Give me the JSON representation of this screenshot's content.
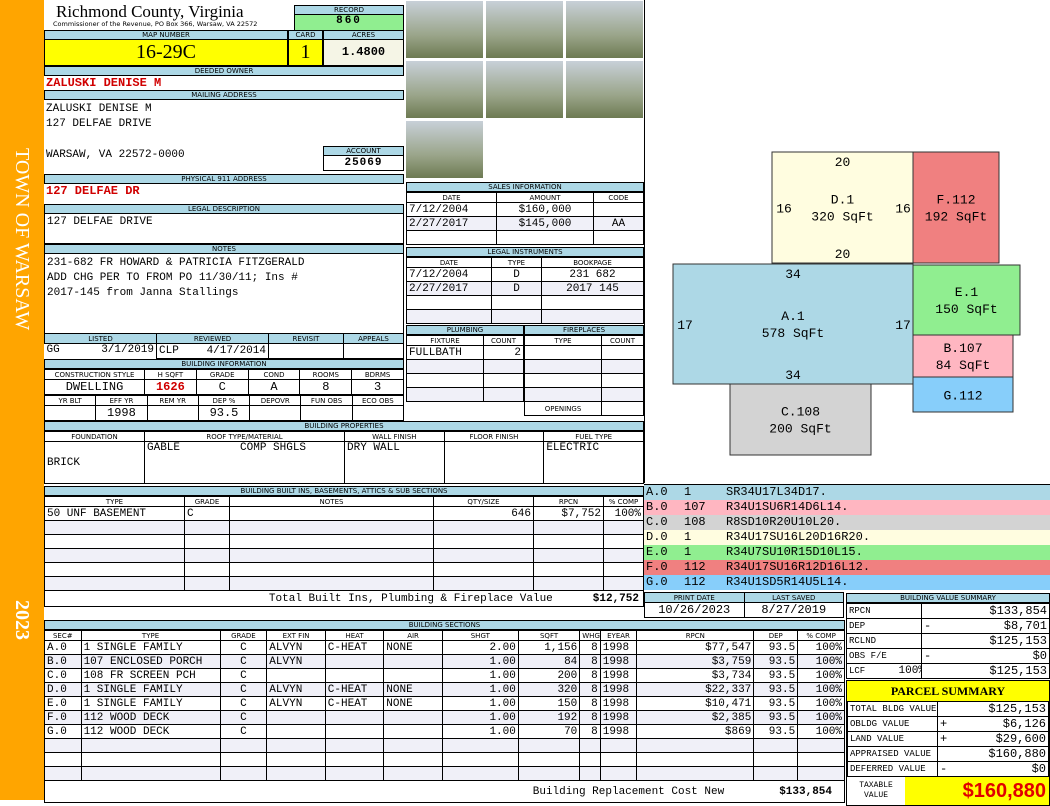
{
  "side": {
    "town": "TOWN OF WARSAW",
    "year": "2023"
  },
  "header": {
    "title": "Richmond County, Virginia",
    "subtitle": "Commissioner of the Revenue, PO Box 366, Warsaw, VA 22572",
    "record_label": "RECORD",
    "record": "860"
  },
  "map": {
    "map_label": "MAP NUMBER",
    "map": "16-29C",
    "card_label": "CARD",
    "card": "1",
    "acres_label": "ACRES",
    "acres": "1.4800"
  },
  "owner": {
    "label": "DEEDED OWNER",
    "name": "ZALUSKI DENISE M"
  },
  "mailing": {
    "label": "MAILING ADDRESS",
    "line1": "ZALUSKI DENISE M",
    "line2": "127 DELFAE DRIVE",
    "line3": "WARSAW, VA 22572-0000",
    "account_label": "ACCOUNT",
    "account": "25069"
  },
  "physical": {
    "label": "PHYSICAL 911 ADDRESS",
    "value": "127 DELFAE DR"
  },
  "legal": {
    "label": "LEGAL DESCRIPTION",
    "value": "127 DELFAE DRIVE"
  },
  "notes": {
    "label": "NOTES",
    "line1": "231-682 FR HOWARD & PATRICIA FITZGERALD",
    "line2": "ADD CHG PER TO FROM PO 11/30/11; Ins #",
    "line3": "2017-145 from Janna Stallings"
  },
  "review": {
    "headers": [
      "LISTED",
      "REVIEWED",
      "REVISIT",
      "APPEALS"
    ],
    "listed_by": "GG",
    "listed": "3/1/2019",
    "reviewed_by": "CLP",
    "reviewed": "4/17/2014"
  },
  "building_info": {
    "label": "BUILDING INFORMATION",
    "headers1": [
      "CONSTRUCTION STYLE",
      "H SQFT",
      "GRADE",
      "COND",
      "ROOMS",
      "BDRMS"
    ],
    "row1": [
      "DWELLING",
      "1626",
      "C",
      "A",
      "8",
      "3"
    ],
    "headers2": [
      "YR BLT",
      "EFF YR",
      "REM YR",
      "DEP %",
      "DEPOVR",
      "FUN OBS",
      "ECO OBS"
    ],
    "row2": [
      "",
      "1998",
      "",
      "93.5",
      "",
      "",
      ""
    ]
  },
  "sales": {
    "label": "SALES INFORMATION",
    "headers": [
      "DATE",
      "AMOUNT",
      "CODE"
    ],
    "rows": [
      [
        "7/12/2004",
        "$160,000",
        ""
      ],
      [
        "2/27/2017",
        "$145,000",
        "AA"
      ],
      [
        "",
        "",
        ""
      ]
    ]
  },
  "instruments": {
    "label": "LEGAL INSTRUMENTS",
    "headers": [
      "DATE",
      "TYPE",
      "BOOKPAGE"
    ],
    "rows": [
      [
        "7/12/2004",
        "D",
        "231 682"
      ],
      [
        "2/27/2017",
        "D",
        "2017 145"
      ],
      [
        "",
        "",
        ""
      ],
      [
        "",
        "",
        ""
      ]
    ]
  },
  "plumbing": {
    "label": "PLUMBING",
    "headers": [
      "FIXTURE",
      "COUNT"
    ],
    "rows": [
      [
        "FULLBATH",
        "2"
      ],
      [
        "",
        ""
      ],
      [
        "",
        ""
      ],
      [
        "",
        ""
      ]
    ]
  },
  "fireplaces": {
    "label": "FIREPLACES",
    "headers": [
      "TYPE",
      "COUNT"
    ],
    "openings": "OPENINGS"
  },
  "properties": {
    "label": "BUILDING PROPERTIES",
    "headers": [
      "FOUNDATION",
      "ROOF TYPE/MATERIAL",
      "WALL FINISH",
      "FLOOR FINISH",
      "FUEL TYPE"
    ],
    "foundation": "BRICK",
    "roof_type": "GABLE",
    "roof_material": "COMP SHGLS",
    "wall": "DRY WALL",
    "floor": "",
    "fuel": "ELECTRIC"
  },
  "builtins": {
    "label": "BUILDING BUILT INS, BASEMENTS, ATTICS & SUB SECTIONS",
    "headers": [
      "TYPE",
      "GRADE",
      "NOTES",
      "QTY/SIZE",
      "RPCN",
      "% COMP"
    ],
    "rows": [
      [
        "50 UNF BASEMENT",
        "C",
        "",
        "646",
        "$7,752",
        "100%"
      ],
      [
        "",
        "",
        "",
        "",
        "",
        ""
      ],
      [
        "",
        "",
        "",
        "",
        "",
        ""
      ],
      [
        "",
        "",
        "",
        "",
        "",
        ""
      ],
      [
        "",
        "",
        "",
        "",
        "",
        ""
      ],
      [
        "",
        "",
        "",
        "",
        "",
        ""
      ]
    ],
    "total_label": "Total Built Ins, Plumbing & Fireplace Value",
    "total": "$12,752"
  },
  "sections": {
    "label": "BUILDING SECTIONS",
    "headers": [
      "SEC#",
      "TYPE",
      "GRADE",
      "EXT FIN",
      "HEAT",
      "AIR",
      "SHGT",
      "SQFT",
      "WHGT",
      "EYEAR",
      "RPCN",
      "DEP",
      "% COMP"
    ],
    "rows": [
      [
        "A.0",
        "1 SINGLE FAMILY",
        "C",
        "ALVYN",
        "C-HEAT",
        "NONE",
        "2.00",
        "1,156",
        "8",
        "1998",
        "$77,547",
        "93.5",
        "100%"
      ],
      [
        "B.0",
        "107 ENCLOSED PORCH",
        "C",
        "ALVYN",
        "",
        "",
        "1.00",
        "84",
        "8",
        "1998",
        "$3,759",
        "93.5",
        "100%"
      ],
      [
        "C.0",
        "108 FR SCREEN PCH",
        "C",
        "",
        "",
        "",
        "1.00",
        "200",
        "8",
        "1998",
        "$3,734",
        "93.5",
        "100%"
      ],
      [
        "D.0",
        "1 SINGLE FAMILY",
        "C",
        "ALVYN",
        "C-HEAT",
        "NONE",
        "1.00",
        "320",
        "8",
        "1998",
        "$22,337",
        "93.5",
        "100%"
      ],
      [
        "E.0",
        "1 SINGLE FAMILY",
        "C",
        "ALVYN",
        "C-HEAT",
        "NONE",
        "1.00",
        "150",
        "8",
        "1998",
        "$10,471",
        "93.5",
        "100%"
      ],
      [
        "F.0",
        "112 WOOD DECK",
        "C",
        "",
        "",
        "",
        "1.00",
        "192",
        "8",
        "1998",
        "$2,385",
        "93.5",
        "100%"
      ],
      [
        "G.0",
        "112 WOOD DECK",
        "C",
        "",
        "",
        "",
        "1.00",
        "70",
        "8",
        "1998",
        "$869",
        "93.5",
        "100%"
      ],
      [
        "",
        "",
        "",
        "",
        "",
        "",
        "",
        "",
        "",
        "",
        "",
        "",
        ""
      ],
      [
        "",
        "",
        "",
        "",
        "",
        "",
        "",
        "",
        "",
        "",
        "",
        "",
        ""
      ],
      [
        "",
        "",
        "",
        "",
        "",
        "",
        "",
        "",
        "",
        "",
        "",
        "",
        ""
      ]
    ],
    "total_label": "Building Replacement Cost New",
    "total": "$133,854"
  },
  "sketch": {
    "shapes": [
      {
        "name": "D.1",
        "area": "320 SqFt",
        "color": "#fffde0",
        "dims": [
          "20",
          "16",
          "16",
          "20"
        ]
      },
      {
        "name": "F.112",
        "area": "192 SqFt",
        "color": "#f08080"
      },
      {
        "name": "A.1",
        "area": "578 SqFt",
        "color": "#add8e6",
        "dims": [
          "34",
          "17",
          "17",
          "34"
        ]
      },
      {
        "name": "E.1",
        "area": "150 SqFt",
        "color": "#90ee90"
      },
      {
        "name": "B.107",
        "area": "84 SqFt",
        "color": "#ffb6c1"
      },
      {
        "name": "G.112",
        "area": "",
        "color": "#87cefa"
      },
      {
        "name": "C.108",
        "area": "200 SqFt",
        "color": "#d3d3d3"
      }
    ]
  },
  "codes": [
    {
      "sec": "A.0",
      "type": "1",
      "path": "SR34U17L34D17.",
      "color": "#add8e6"
    },
    {
      "sec": "B.0",
      "type": "107",
      "path": "R34U1SU6R14D6L14.",
      "color": "#ffb6c1"
    },
    {
      "sec": "C.0",
      "type": "108",
      "path": "R8SD10R20U10L20.",
      "color": "#d3d3d3"
    },
    {
      "sec": "D.0",
      "type": "1",
      "path": "R34U17SU16L20D16R20.",
      "color": "#fffde0"
    },
    {
      "sec": "E.0",
      "type": "1",
      "path": "R34U7SU10R15D10L15.",
      "color": "#90ee90"
    },
    {
      "sec": "F.0",
      "type": "112",
      "path": "R34U17SU16R12D16L12.",
      "color": "#f08080"
    },
    {
      "sec": "G.0",
      "type": "112",
      "path": "R34U1SD5R14U5L14.",
      "color": "#87cefa"
    }
  ],
  "dates": {
    "print_label": "PRINT DATE",
    "print": "10/26/2023",
    "saved_label": "LAST SAVED",
    "saved": "8/27/2019"
  },
  "value_summary": {
    "label": "BUILDING VALUE SUMMARY",
    "rows": [
      [
        "RPCN",
        "",
        "",
        "$133,854"
      ],
      [
        "DEP",
        "",
        "-",
        "$8,701"
      ],
      [
        "RCLND",
        "",
        "",
        "$125,153"
      ],
      [
        "OBS F/E",
        "",
        "-",
        "$0"
      ],
      [
        "LCF",
        "100%",
        "",
        "$125,153"
      ]
    ]
  },
  "parcel": {
    "label": "PARCEL SUMMARY",
    "rows": [
      [
        "TOTAL BLDG VALUE",
        "",
        "$125,153"
      ],
      [
        "OBLDG VALUE",
        "+",
        "$6,126"
      ],
      [
        "LAND VALUE",
        "+",
        "$29,600"
      ],
      [
        "APPRAISED VALUE",
        "",
        "$160,880"
      ],
      [
        "DEFERRED VALUE",
        "-",
        "$0"
      ]
    ],
    "taxable_label": "TAXABLE VALUE",
    "taxable": "$160,880"
  }
}
